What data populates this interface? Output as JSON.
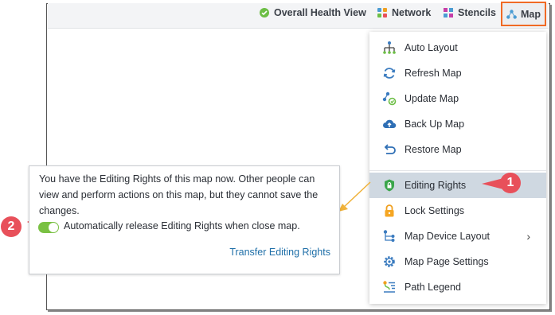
{
  "toolbar": {
    "items": [
      {
        "label": "Overall Health View",
        "icon": "health-check-icon",
        "color": "#6cbe45"
      },
      {
        "label": "Network",
        "icon": "network-grid-icon",
        "color": "#4b9cd3"
      },
      {
        "label": "Stencils",
        "icon": "stencils-icon",
        "color": "#c63ea8"
      },
      {
        "label": "Map",
        "icon": "map-icon",
        "color": "#4b9cd3",
        "selected": true
      }
    ],
    "accent": "#f06a25"
  },
  "menu": {
    "items": [
      {
        "label": "Auto Layout",
        "icon": "auto-layout-icon"
      },
      {
        "label": "Refresh Map",
        "icon": "refresh-icon"
      },
      {
        "label": "Update Map",
        "icon": "update-map-icon"
      },
      {
        "label": "Back Up Map",
        "icon": "cloud-upload-icon"
      },
      {
        "label": "Restore Map",
        "icon": "restore-icon"
      },
      {
        "label": "Editing Rights",
        "icon": "shield-lock-icon",
        "active": true
      },
      {
        "label": "Lock Settings",
        "icon": "lock-icon"
      },
      {
        "label": "Map Device Layout",
        "icon": "device-layout-icon",
        "submenu": true
      },
      {
        "label": "Map Page Settings",
        "icon": "gear-icon"
      },
      {
        "label": "Path Legend",
        "icon": "path-legend-icon"
      }
    ],
    "chevron": "›"
  },
  "callouts": {
    "one": "1",
    "two": "2",
    "color": "#e8505a"
  },
  "tooltip": {
    "message": "You have the Editing Rights of this map now. Other people can view and perform actions on this map, but they cannot save the changes.",
    "toggle_label": "Automatically release Editing Rights when close map.",
    "toggle_on": true,
    "transfer_link": "Transfer Editing Rights"
  }
}
